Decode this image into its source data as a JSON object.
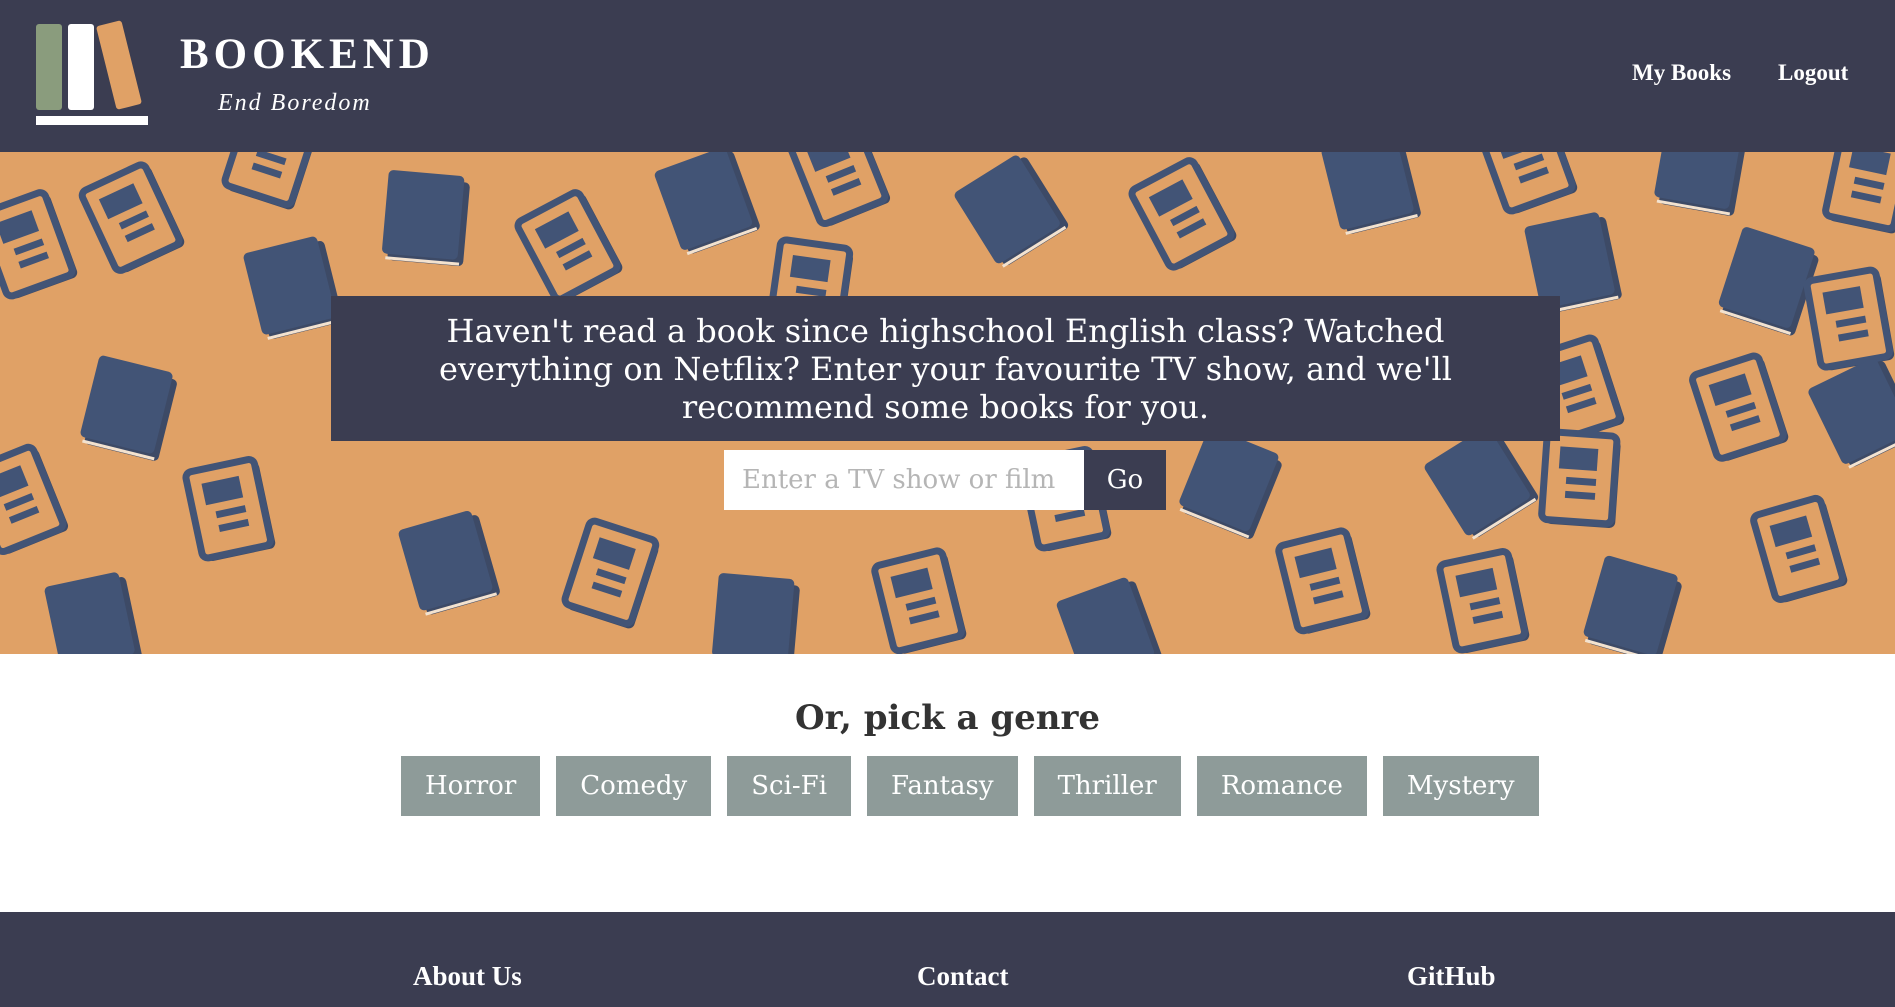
{
  "header": {
    "brand_title": "BOOKEND",
    "brand_tagline": "End Boredom",
    "nav": [
      {
        "label": "My Books"
      },
      {
        "label": "Logout"
      }
    ]
  },
  "hero": {
    "message": "Haven't read a book since highschool English class? Watched everything on Netflix? Enter your favourite TV show, and we'll recommend some books for you.",
    "search": {
      "placeholder": "Enter a TV show or film",
      "value": "",
      "button_label": "Go"
    }
  },
  "genres": {
    "heading": "Or, pick a genre",
    "items": [
      {
        "label": "Horror"
      },
      {
        "label": "Comedy"
      },
      {
        "label": "Sci-Fi"
      },
      {
        "label": "Fantasy"
      },
      {
        "label": "Thriller"
      },
      {
        "label": "Romance"
      },
      {
        "label": "Mystery"
      }
    ]
  },
  "footer": {
    "about_label": "About Us",
    "contact_label": "Contact",
    "github_label": "GitHub"
  },
  "colors": {
    "header_bg": "#3b3d51",
    "hero_bg": "#e0a166",
    "book_blue": "#425476",
    "genre_button": "#8e9b99",
    "logo_green": "#8a9c7d",
    "logo_orange": "#e0a166"
  }
}
